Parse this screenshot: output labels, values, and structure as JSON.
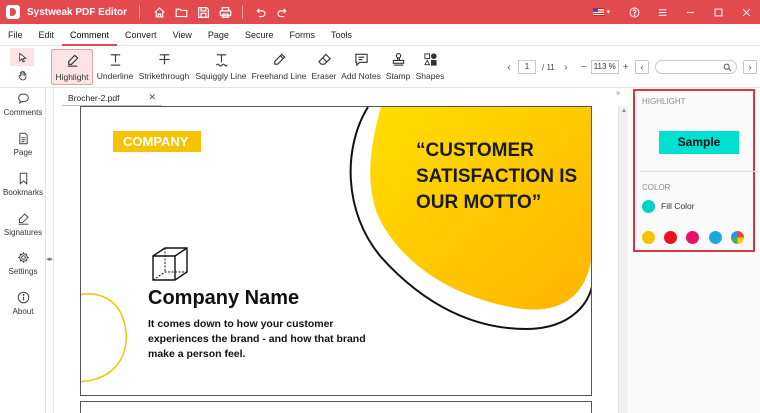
{
  "app": {
    "title": "Systweak PDF Editor",
    "language_flag": "us-flag"
  },
  "title_icons": [
    "home-icon",
    "open-folder-icon",
    "save-icon",
    "print-icon",
    "undo-icon",
    "redo-icon"
  ],
  "menu": [
    "File",
    "Edit",
    "Comment",
    "Convert",
    "View",
    "Page",
    "Secure",
    "Forms",
    "Tools"
  ],
  "menu_active": "Comment",
  "toolbar": {
    "tools": [
      {
        "label": "Highlight",
        "icon": "highlighter-icon"
      },
      {
        "label": "Underline",
        "icon": "underline-text-icon"
      },
      {
        "label": "Strikethrough",
        "icon": "strikethrough-text-icon"
      },
      {
        "label": "Squiggly Line",
        "icon": "squiggly-text-icon"
      },
      {
        "label": "Freehand Line",
        "icon": "freehand-icon"
      },
      {
        "label": "Eraser",
        "icon": "eraser-icon"
      },
      {
        "label": "Add Notes",
        "icon": "note-icon"
      },
      {
        "label": "Stamp",
        "icon": "stamp-icon"
      },
      {
        "label": "Shapes",
        "icon": "shapes-icon"
      }
    ],
    "active_tool": "Highlight",
    "page_current": "1",
    "page_total": "/ 11",
    "zoom": "113 %"
  },
  "sidebar": [
    {
      "label": "Comments",
      "icon": "comment-icon"
    },
    {
      "label": "Page",
      "icon": "page-icon"
    },
    {
      "label": "Bookmarks",
      "icon": "bookmark-icon"
    },
    {
      "label": "Signatures",
      "icon": "signature-icon"
    },
    {
      "label": "Settings",
      "icon": "gear-icon"
    },
    {
      "label": "About",
      "icon": "info-icon"
    }
  ],
  "document": {
    "tab_name": "Brocher-2.pdf",
    "badge": "COMPANY",
    "quote": "“CUSTOMER SATISFACTION IS OUR MOTTO”",
    "company_name": "Company Name",
    "tagline": "It comes down to how your customer experiences the brand - and how that brand make a person feel.",
    "accent_color": "#f5c400"
  },
  "right_panel": {
    "highlight_heading": "HIGHLIGHT",
    "sample": "Sample",
    "color_heading": "COLOR",
    "fill_label": "Fill Color",
    "fill_color": "#00d2c8",
    "swatches": [
      "#f5c400",
      "#e8131b",
      "#e8126a",
      "#1fa5e0",
      "multicolor"
    ]
  },
  "colors": {
    "brand": "#e24a4f",
    "panel_outline": "#d9363e",
    "sample_highlight": "#00e0d0"
  }
}
